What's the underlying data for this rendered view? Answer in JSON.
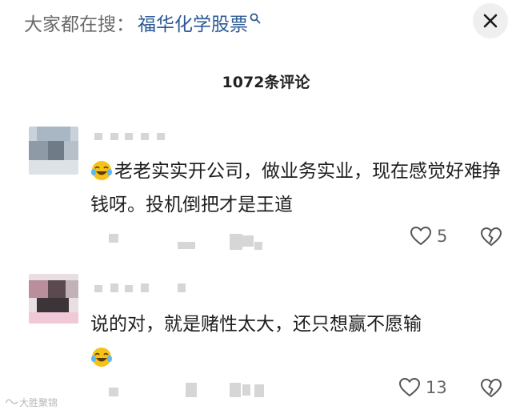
{
  "search": {
    "prefix": "大家都在搜：",
    "query": "福华化学股票",
    "icon": "search-icon"
  },
  "close_icon": "close-icon",
  "header": {
    "comment_count": "1072条评论"
  },
  "comments": [
    {
      "text": "老老实实开公司，做业务实业，现在感觉好难挣钱呀。投机倒把才是王道",
      "emoji": "laughing-tears-emoji",
      "likes": "5"
    },
    {
      "text": "说的对，就是赌性太大，还只想赢不愿输",
      "emoji": "laughing-tears-emoji",
      "likes": "13"
    }
  ],
  "watermark": {
    "text": "大胜聚锦"
  },
  "colors": {
    "link": "#2c5a96",
    "emoji": "#f5c21b",
    "mosaic": "#d6d6d6"
  }
}
